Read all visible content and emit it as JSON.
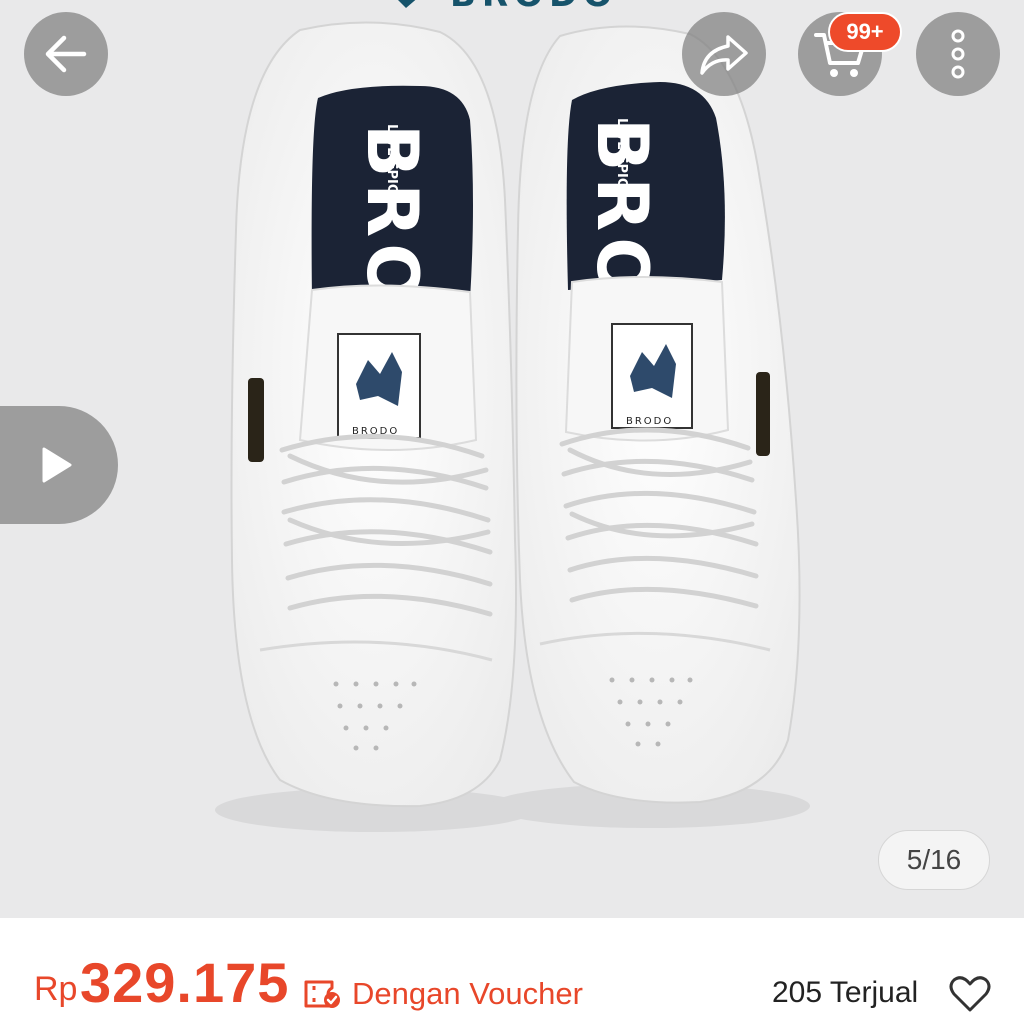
{
  "gallery": {
    "brand_word": "BRODO",
    "insole_text": "BRO",
    "insole_tagline": "LIVE EPIC",
    "tag_text": "BRODO",
    "counter": "5/16",
    "counter_current": 5,
    "counter_total": 16
  },
  "toolbar": {
    "back_icon": "arrow-left-icon",
    "share_icon": "share-arrow-icon",
    "cart_icon": "shopping-cart-icon",
    "cart_badge": "99+",
    "more_icon": "vertical-dots-icon"
  },
  "video": {
    "icon": "play-icon"
  },
  "product": {
    "currency": "Rp",
    "price": "329.175",
    "voucher_icon": "voucher-ticket-icon",
    "voucher_label": "Dengan Voucher",
    "sold": "205 Terjual",
    "wishlist_icon": "heart-outline-icon"
  },
  "colors": {
    "accent": "#e8472a",
    "badge": "#ee4a2a",
    "overlay_button": "#808080",
    "photo_background": "#e9e9ea",
    "insole": "#1b2335",
    "brand": "#16536b"
  }
}
